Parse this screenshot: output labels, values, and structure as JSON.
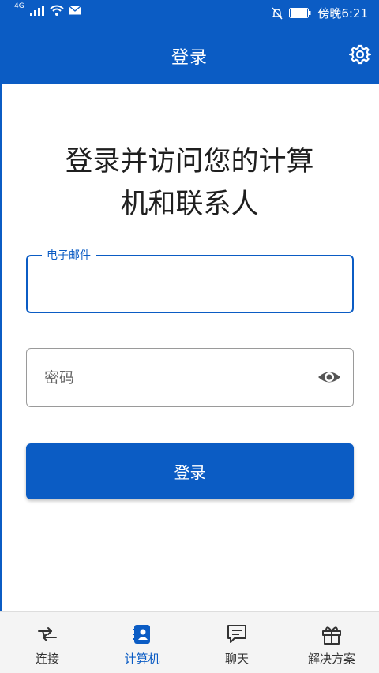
{
  "status_bar": {
    "network": "4G",
    "time": "傍晚6:21"
  },
  "header": {
    "title": "登录",
    "settings_icon": "gear-icon"
  },
  "main": {
    "headline_line1": "登录并访问您的计算",
    "headline_line2": "机和联系人",
    "email": {
      "label": "电子邮件",
      "value": ""
    },
    "password": {
      "placeholder": "密码",
      "value": "",
      "toggle_icon": "eye-icon"
    },
    "login_button": "登录"
  },
  "bottom_nav": {
    "items": [
      {
        "label": "连接",
        "icon": "connect-arrows-icon",
        "active": false
      },
      {
        "label": "计算机",
        "icon": "contacts-book-icon",
        "active": true
      },
      {
        "label": "聊天",
        "icon": "chat-bubble-icon",
        "active": false
      },
      {
        "label": "解决方案",
        "icon": "gift-box-icon",
        "active": false
      }
    ]
  },
  "colors": {
    "primary": "#0b5cc4",
    "background": "#ffffff",
    "nav_background": "#f4f4f4"
  }
}
